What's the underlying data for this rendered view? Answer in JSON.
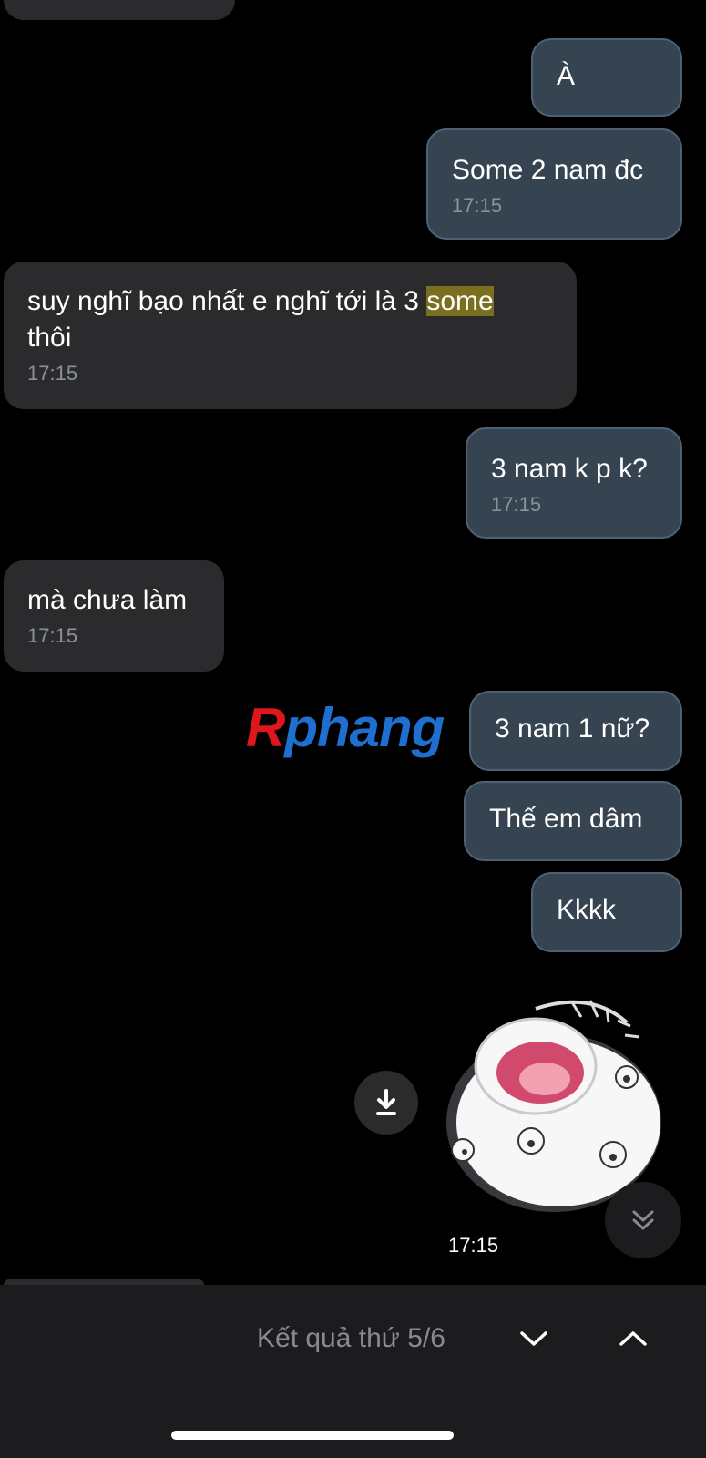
{
  "messages": [
    {
      "id": "m1",
      "side": "out",
      "text": "À",
      "time": ""
    },
    {
      "id": "m2",
      "side": "out",
      "text": "Some 2 nam đc",
      "time": "17:15"
    },
    {
      "id": "m3",
      "side": "in",
      "text_before": "suy nghĩ bạo nhất e nghĩ tới là 3 ",
      "highlight": "some",
      "text_after": "\nthôi",
      "time": "17:15"
    },
    {
      "id": "m4",
      "side": "out",
      "text": "3 nam k p k?",
      "time": "17:15"
    },
    {
      "id": "m5",
      "side": "in",
      "text": "mà chưa làm",
      "time": "17:15"
    },
    {
      "id": "m6",
      "side": "out",
      "text": "3 nam 1 nữ?",
      "time": ""
    },
    {
      "id": "m7",
      "side": "out",
      "text": "Thế em dâm",
      "time": ""
    },
    {
      "id": "m8",
      "side": "out",
      "text": "Kkkk",
      "time": ""
    }
  ],
  "watermark": {
    "first": "R",
    "rest": "phang"
  },
  "sticker": {
    "time": "17:15",
    "icon": "sticker-cat-image"
  },
  "search_bar": {
    "result_text": "Kết quả thứ 5/6"
  },
  "colors": {
    "incoming_bubble": "#2b2b2d",
    "outgoing_bubble": "#364452",
    "highlight": "#7a6f1e",
    "background": "#000000"
  }
}
